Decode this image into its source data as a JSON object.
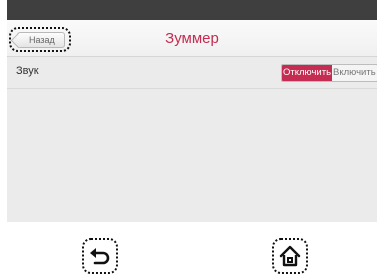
{
  "header": {
    "back_label": "Назад",
    "title": "Зуммер"
  },
  "settings": {
    "sound_label": "Звук",
    "options": [
      "Отключить",
      "Включить"
    ],
    "selected": "Отключить"
  },
  "colors": {
    "accent": "#c42c52",
    "status_bar": "#3f3f3f",
    "screen_bg": "#ebebeb"
  },
  "bottom_bar": {
    "icons": [
      "undo-arrow-icon",
      "home-icon"
    ]
  }
}
